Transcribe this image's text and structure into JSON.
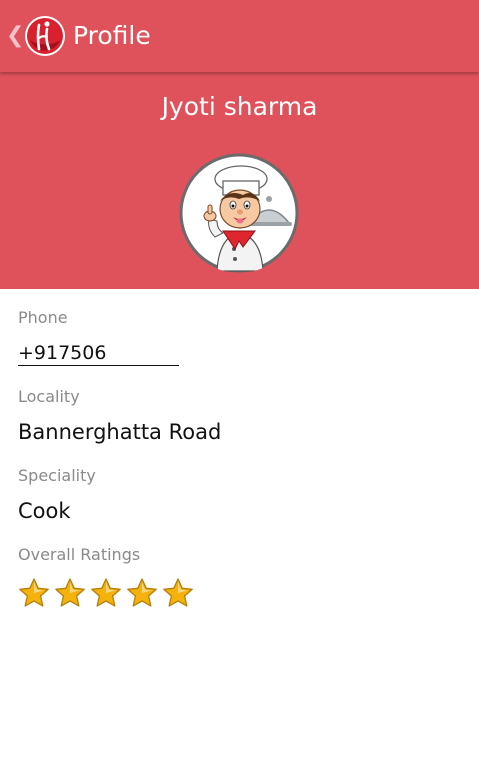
{
  "action_bar": {
    "title": "Profile",
    "back_icon": "chevron-left-icon",
    "logo_icon": "app-logo-icon"
  },
  "profile": {
    "name": "Jyoti sharma",
    "avatar_icon": "chef-avatar-icon"
  },
  "fields": {
    "phone": {
      "label": "Phone",
      "value": "+917506"
    },
    "locality": {
      "label": "Locality",
      "value": "Bannerghatta Road"
    },
    "speciality": {
      "label": "Speciality",
      "value": "Cook"
    },
    "ratings": {
      "label": "Overall Ratings",
      "value": 5,
      "max": 5
    }
  },
  "colors": {
    "accent": "#df525c",
    "label_gray": "#8a8a8a",
    "text_dark": "#111111",
    "star_gold": "#f4b20d"
  }
}
